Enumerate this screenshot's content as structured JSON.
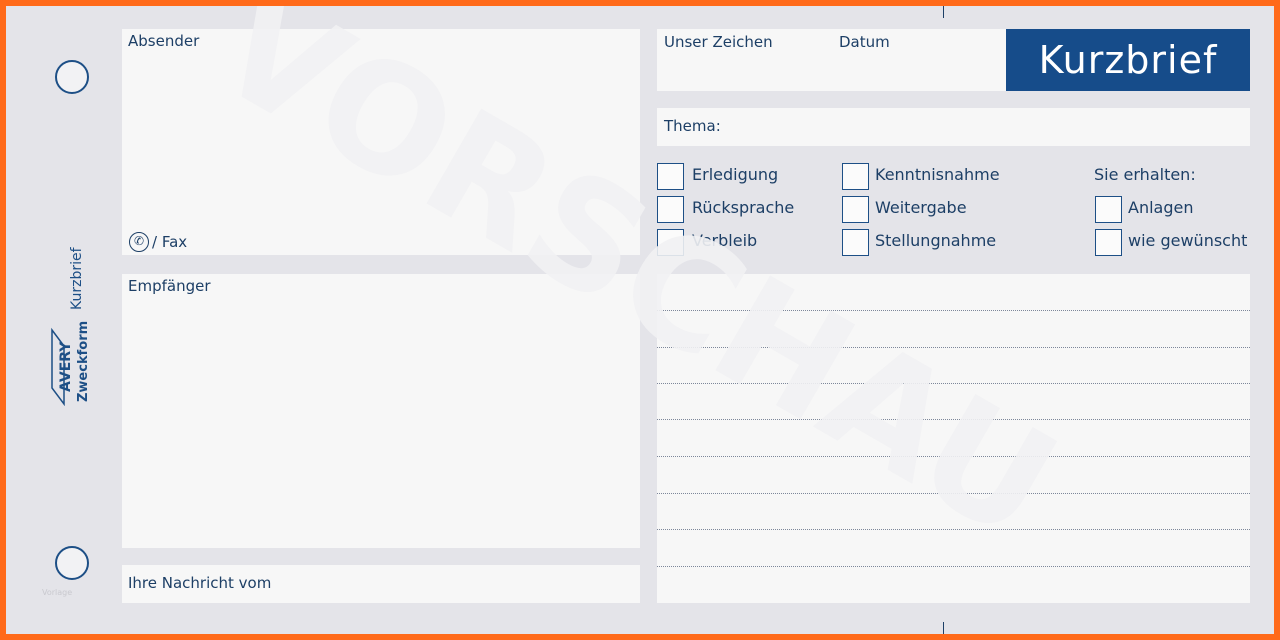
{
  "form": {
    "title": "Kurzbrief",
    "side_label": "Kurzbrief",
    "brand_line1": "AVERY",
    "brand_line2": "Zweckform",
    "corner_note": "Vorlage",
    "watermark": "VORSCHAU"
  },
  "fields": {
    "absender": "Absender",
    "fax": "/ Fax",
    "empfaenger": "Empfänger",
    "ihre_nachricht": "Ihre Nachricht vom",
    "unser_zeichen": "Unser Zeichen",
    "datum": "Datum",
    "thema": "Thema:",
    "sie_erhalten": "Sie erhalten:"
  },
  "checkboxes": {
    "col1": [
      "Erledigung",
      "Rücksprache",
      "Verbleib"
    ],
    "col2": [
      "Kenntnisnahme",
      "Weitergabe",
      "Stellungnahme"
    ],
    "col3": [
      "Anlagen",
      "wie gewünscht"
    ]
  },
  "colors": {
    "frame": "#ff6a1a",
    "paper": "#e4e4e9",
    "field": "#f7f7f7",
    "ink": "#1d3f66",
    "title_box": "#164c8a"
  },
  "icons": {
    "phone": "telephone-icon"
  }
}
